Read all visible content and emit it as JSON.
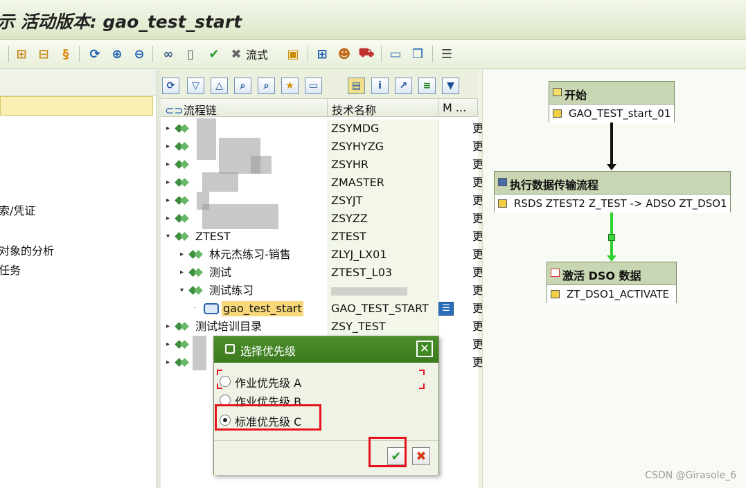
{
  "window": {
    "title": "示 活动版本: gao_test_start"
  },
  "toolbar": {
    "icons": [
      "hierarchy-icon",
      "tree-icon",
      "scroll-icon",
      "refresh-icon",
      "zoom-in-icon",
      "zoom-out-icon",
      "glasses-icon",
      "new-doc-icon",
      "check-icon",
      "cancel-icon",
      "calendar-icon",
      "network-icon",
      "person-icon",
      "truck-icon",
      "monitor-icon",
      "copy-icon",
      "list-icon"
    ],
    "liushi_label": "流式"
  },
  "left": {
    "items": [
      "索/凭证",
      "对象的分析",
      "任务"
    ]
  },
  "tree": {
    "col_chain": "流程链",
    "col_tech": "技术名称",
    "col_m": "M ...",
    "rows": [
      {
        "label": "",
        "tech": "ZSYMDG",
        "m": "更"
      },
      {
        "label": "",
        "tech": "ZSYHYZG",
        "m": "更"
      },
      {
        "label": "",
        "tech": "ZSYHR",
        "m": "更"
      },
      {
        "label": "",
        "tech": "ZMASTER",
        "m": "更"
      },
      {
        "label": "",
        "tech": "ZSYJT",
        "m": "更"
      },
      {
        "label": "",
        "tech": "ZSYZZ",
        "m": "更"
      },
      {
        "label": "ZTEST",
        "tech": "ZTEST",
        "m": "更"
      },
      {
        "label": "林元杰练习-销售",
        "tech": "ZLYJ_LX01",
        "m": "更"
      },
      {
        "label": "测试",
        "tech": "ZTEST_L03",
        "m": "更"
      },
      {
        "label": "测试练习",
        "tech": "",
        "m": "更"
      },
      {
        "label": "gao_test_start",
        "tech": "GAO_TEST_START",
        "m": "更"
      },
      {
        "label": "测试培训目录",
        "tech": "ZSY_TEST",
        "m": "更"
      },
      {
        "label": "",
        "tech": "",
        "m": "更"
      },
      {
        "label": "",
        "tech": "",
        "m": "更"
      }
    ]
  },
  "flow": {
    "start": {
      "header": "开始",
      "body": "GAO_TEST_start_01"
    },
    "dtp": {
      "header": "执行数据传输流程",
      "body": "RSDS ZTEST2 Z_TEST -> ADSO ZT_DSO1"
    },
    "activate": {
      "header": "激活 DSO 数据",
      "body": "ZT_DSO1_ACTIVATE"
    }
  },
  "dialog": {
    "title": "选择优先级",
    "options": [
      "作业优先级 A",
      "作业优先级 B",
      "标准优先级 C"
    ],
    "selected": 2,
    "ok_icon": "check-icon",
    "cancel_icon": "cancel-icon"
  },
  "watermark": "CSDN @Girasole_6",
  "colors": {
    "accent_green": "#3c7a1f",
    "highlight_red": "#e8121c",
    "selected_yellow": "#f7d77a"
  }
}
